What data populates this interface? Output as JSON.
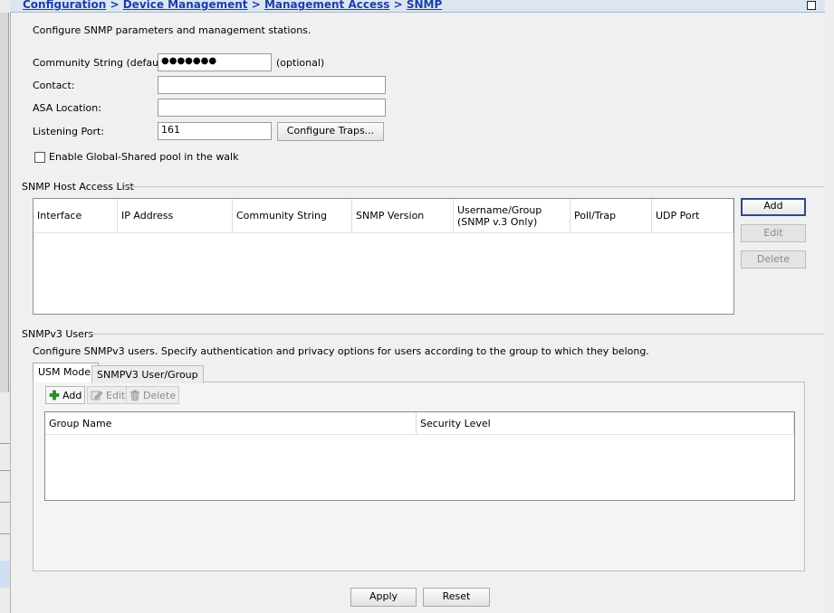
{
  "header": {
    "breadcrumb": [
      "Configuration",
      "Device Management",
      "Management Access",
      "SNMP"
    ],
    "separator": ">"
  },
  "intro": "Configure SNMP parameters and management stations.",
  "form": {
    "community_label": "Community String (default):",
    "community_value": "●●●●●●●",
    "community_hint": "(optional)",
    "contact_label": "Contact:",
    "contact_value": "",
    "location_label": "ASA Location:",
    "location_value": "",
    "port_label": "Listening Port:",
    "port_value": "161",
    "configure_traps": "Configure Traps...",
    "global_shared_label": "Enable Global-Shared pool in the walk",
    "global_shared_checked": false
  },
  "host_access": {
    "title": "SNMP Host Access List",
    "columns": [
      "Interface",
      "IP Address",
      "Community String",
      "SNMP Version",
      "Username/Group\n(SNMP v.3 Only)",
      "Poll/Trap",
      "UDP Port"
    ],
    "rows": [],
    "add": "Add",
    "edit": "Edit",
    "delete": "Delete"
  },
  "snmpv3": {
    "title": "SNMPv3 Users",
    "description": "Configure SNMPv3 users. Specify authentication and privacy options for users according to the group to which they belong.",
    "tabs": [
      "USM Model",
      "SNMPV3 User/Group"
    ],
    "active_tab": 0,
    "toolbar": {
      "add": "Add",
      "edit": "Edit",
      "delete": "Delete"
    },
    "columns": [
      "Group Name",
      "Security Level"
    ],
    "rows": []
  },
  "footer": {
    "apply": "Apply",
    "reset": "Reset"
  },
  "colors": {
    "link": "#1c3fa8",
    "header_bg": "#dce6f3",
    "panel_bg": "#f0f0f0",
    "add_icon": "#2a9a2a"
  }
}
